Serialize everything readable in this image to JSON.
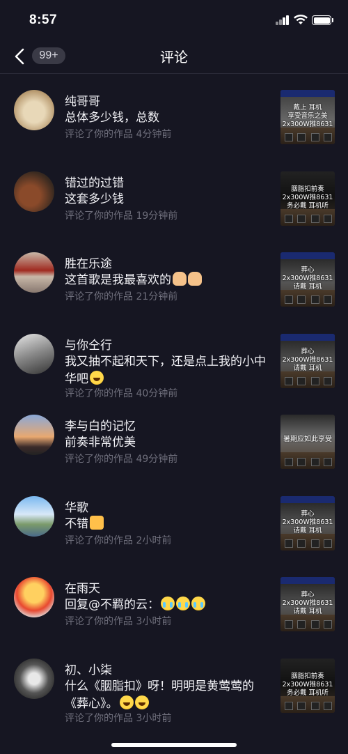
{
  "status_bar": {
    "time": "8:57"
  },
  "nav": {
    "badge": "99+",
    "title": "评论"
  },
  "comments": [
    {
      "name": "纯哥哥",
      "text": "总体多少钱，总数",
      "action": "评论了你的作品",
      "time": "4分钟前",
      "thumb_text": "戴上  耳机\n享受音乐之美\n2x300W推8631",
      "emojis": []
    },
    {
      "name": "错过的过错",
      "text": "这套多少钱",
      "action": "评论了你的作品",
      "time": "19分钟前",
      "thumb_text": "胭脂扣前奏\n2x300W推8631\n务必戴  耳机听",
      "emojis": []
    },
    {
      "name": "胜在乐途",
      "text": "这首歌是我最喜欢的",
      "action": "评论了你的作品",
      "time": "21分钟前",
      "thumb_text": "葬心\n2x300W推8631\n请戴  耳机",
      "emojis": [
        "pray",
        "pray"
      ]
    },
    {
      "name": "与你仝行",
      "text": "我又抽不起和天下，还是点上我的小中华吧",
      "action": "评论了你的作品",
      "time": "40分钟前",
      "thumb_text": "葬心\n2x300W推8631\n请戴  耳机",
      "emojis": [
        "laugh"
      ]
    },
    {
      "name": "李与白的记忆",
      "text": "前奏非常优美",
      "action": "评论了你的作品",
      "time": "49分钟前",
      "thumb_text": "暑期应如此享受",
      "emojis": []
    },
    {
      "name": "华歌",
      "text": "不错",
      "action": "评论了你的作品",
      "time": "2小时前",
      "thumb_text": "葬心\n2x300W推8631\n请戴  耳机",
      "emojis": [
        "thumb-up"
      ]
    },
    {
      "name": "在雨天",
      "text": "回复@不羁的云：",
      "action": "评论了你的作品",
      "time": "3小时前",
      "thumb_text": "葬心\n2x300W推8631\n请戴  耳机",
      "emojis": [
        "cry",
        "cry",
        "cry"
      ]
    },
    {
      "name": "初、小柒",
      "text": "什么《胭脂扣》呀！明明是黄莺莺的《葬心》。",
      "action": "评论了你的作品",
      "time": "3小时前",
      "thumb_text": "胭脂扣前奏\n2x300W推8631\n务必戴  耳机听",
      "emojis": [
        "laugh",
        "laugh"
      ]
    }
  ],
  "colors": {
    "background": "#161622",
    "meta_text": "#6f6f7c",
    "divider": "#2a2a38"
  },
  "icons": {
    "back": "chevron-left-icon",
    "wifi": "wifi-icon",
    "signal": "signal-icon",
    "battery": "battery-icon"
  }
}
